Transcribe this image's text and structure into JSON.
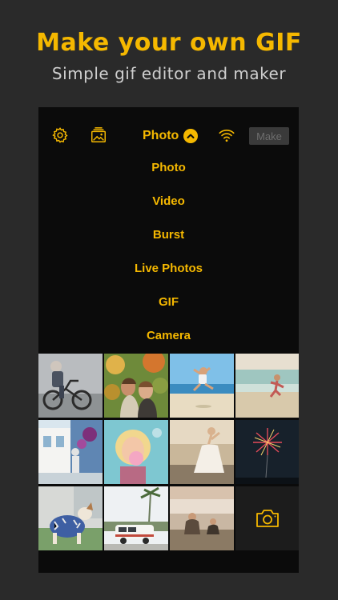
{
  "promo": {
    "headline": "Make your own GIF",
    "subheadline": "Simple gif editor and maker"
  },
  "topbar": {
    "settings_icon": "gear-icon",
    "album_icon": "photo-album-icon",
    "source_label": "Photo",
    "source_chevron_icon": "chevron-up-icon",
    "wifi_icon": "wifi-icon",
    "make_label": "Make"
  },
  "menu": {
    "items": [
      {
        "label": "Photo"
      },
      {
        "label": "Video"
      },
      {
        "label": "Burst"
      },
      {
        "label": "Live Photos"
      },
      {
        "label": "GIF"
      },
      {
        "label": "Camera"
      }
    ]
  },
  "grid": {
    "thumbnails": [
      {
        "subject": "child on bicycle"
      },
      {
        "subject": "two girls under tree"
      },
      {
        "subject": "girl jumping at beach"
      },
      {
        "subject": "girl running on shore"
      },
      {
        "subject": "girl at white building"
      },
      {
        "subject": "girl blowing bubblegum"
      },
      {
        "subject": "bride walking on street"
      },
      {
        "subject": "fireworks at night"
      },
      {
        "subject": "dog in blue sweater"
      },
      {
        "subject": "white van under palms"
      },
      {
        "subject": "women sitting by lake"
      }
    ],
    "camera_icon": "camera-icon"
  },
  "colors": {
    "accent": "#f5b800",
    "background": "#2a2a2a",
    "panel": "#0b0b0b",
    "muted_text": "#cfcfcf"
  }
}
